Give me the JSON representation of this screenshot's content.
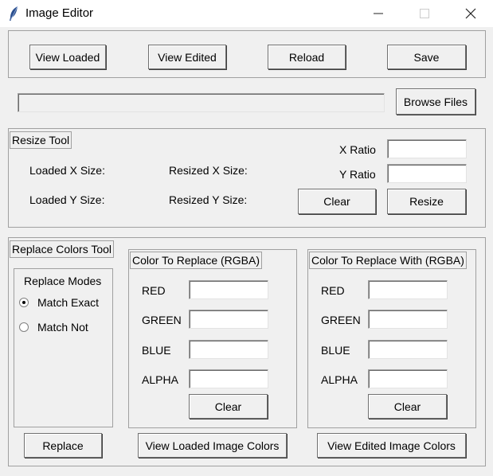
{
  "window": {
    "title": "Image Editor",
    "icons": {
      "app": "feather-icon",
      "minimize": "minimize-icon",
      "maximize": "maximize-icon",
      "close": "close-icon"
    }
  },
  "toolbar": {
    "view_loaded": "View Loaded",
    "view_edited": "View Edited",
    "reload": "Reload",
    "save": "Save"
  },
  "file_path": {
    "value": "",
    "browse": "Browse Files"
  },
  "resize_tool": {
    "title": "Resize Tool",
    "loaded_x": "Loaded X Size:",
    "loaded_y": "Loaded Y Size:",
    "resized_x": "Resized X Size:",
    "resized_y": "Resized Y Size:",
    "x_ratio_label": "X Ratio",
    "y_ratio_label": "Y Ratio",
    "x_ratio_value": "",
    "y_ratio_value": "",
    "clear": "Clear",
    "resize": "Resize"
  },
  "replace_tool": {
    "title": "Replace Colors Tool",
    "modes": {
      "title": "Replace Modes",
      "options": [
        {
          "label": "Match Exact",
          "selected": true
        },
        {
          "label": "Match Not",
          "selected": false
        }
      ]
    },
    "replace_group": {
      "title": "Color To Replace (RGBA)",
      "red": "RED",
      "green": "GREEN",
      "blue": "BLUE",
      "alpha": "ALPHA",
      "red_value": "",
      "green_value": "",
      "blue_value": "",
      "alpha_value": "",
      "clear": "Clear"
    },
    "with_group": {
      "title": "Color To Replace With (RGBA)",
      "red": "RED",
      "green": "GREEN",
      "blue": "BLUE",
      "alpha": "ALPHA",
      "red_value": "",
      "green_value": "",
      "blue_value": "",
      "alpha_value": "",
      "clear": "Clear"
    },
    "replace_button": "Replace",
    "view_loaded_colors": "View Loaded Image Colors",
    "view_edited_colors": "View Edited Image Colors"
  },
  "colors": {
    "background": "#f0f0f0",
    "titlebar": "#ffffff",
    "border": "#a0a0a0"
  }
}
